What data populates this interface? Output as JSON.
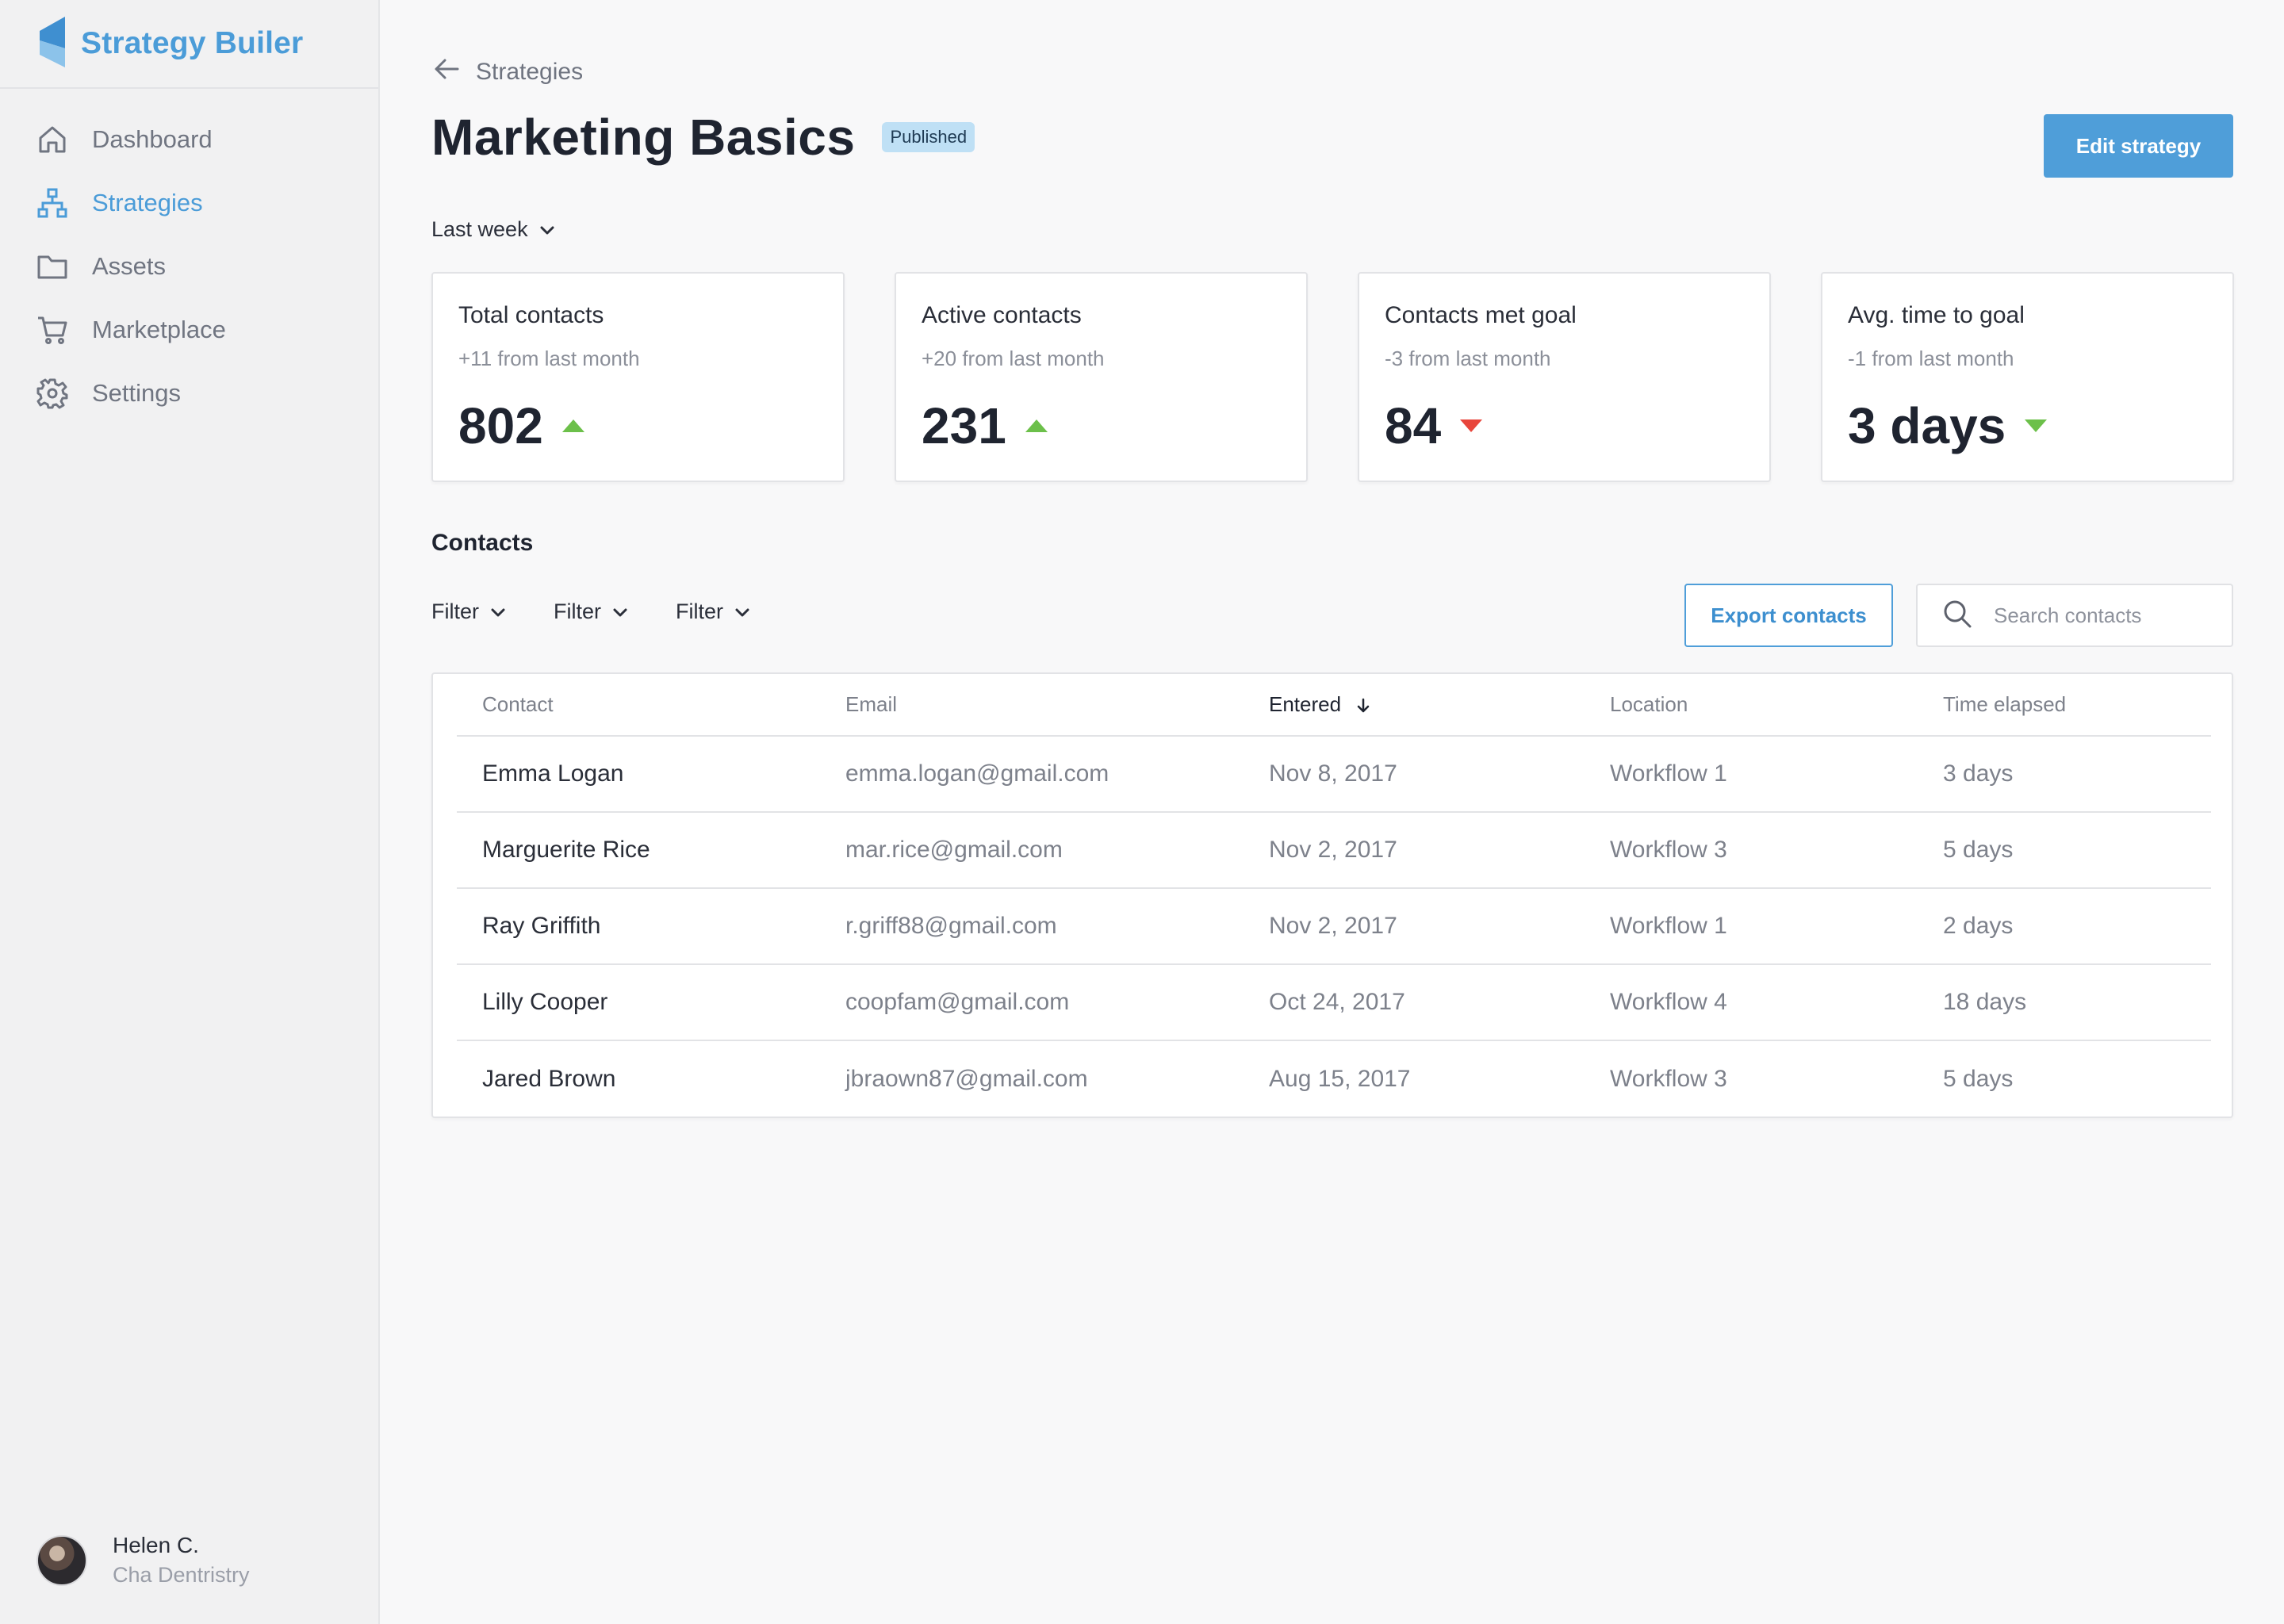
{
  "app": {
    "name": "Strategy Builer"
  },
  "sidebar": {
    "items": [
      {
        "label": "Dashboard",
        "icon": "home-icon",
        "active": false
      },
      {
        "label": "Strategies",
        "icon": "hierarchy-icon",
        "active": true
      },
      {
        "label": "Assets",
        "icon": "folder-icon",
        "active": false
      },
      {
        "label": "Marketplace",
        "icon": "cart-icon",
        "active": false
      },
      {
        "label": "Settings",
        "icon": "gear-icon",
        "active": false
      }
    ],
    "user": {
      "name": "Helen C.",
      "org": "Cha Dentristry"
    }
  },
  "header": {
    "back_label": "Strategies",
    "title": "Marketing Basics",
    "status": "Published",
    "edit_label": "Edit strategy",
    "range": "Last week"
  },
  "stats": [
    {
      "title": "Total contacts",
      "change": "+11 from last month",
      "value": "802",
      "trend": "up",
      "trend_color": "#6cc04a"
    },
    {
      "title": "Active contacts",
      "change": "+20 from last month",
      "value": "231",
      "trend": "up",
      "trend_color": "#6cc04a"
    },
    {
      "title": "Contacts met goal",
      "change": "-3 from last month",
      "value": "84",
      "trend": "down",
      "trend_color": "#e8463c"
    },
    {
      "title": "Avg. time to goal",
      "change": "-1 from last month",
      "value": "3 days",
      "trend": "down",
      "trend_color": "#6cc04a"
    }
  ],
  "contacts": {
    "title": "Contacts",
    "filters": [
      "Filter",
      "Filter",
      "Filter"
    ],
    "export_label": "Export contacts",
    "search_placeholder": "Search contacts",
    "columns": [
      "Contact",
      "Email",
      "Entered",
      "Location",
      "Time elapsed"
    ],
    "sorted_column": "Entered",
    "rows": [
      {
        "name": "Emma Logan",
        "email": "emma.logan@gmail.com",
        "entered": "Nov 8, 2017",
        "location": "Workflow 1",
        "elapsed": "3 days"
      },
      {
        "name": "Marguerite Rice",
        "email": "mar.rice@gmail.com",
        "entered": "Nov 2, 2017",
        "location": "Workflow 3",
        "elapsed": "5 days"
      },
      {
        "name": "Ray Griffith",
        "email": "r.griff88@gmail.com",
        "entered": "Nov 2, 2017",
        "location": "Workflow 1",
        "elapsed": "2 days"
      },
      {
        "name": "Lilly Cooper",
        "email": "coopfam@gmail.com",
        "entered": "Oct 24, 2017",
        "location": "Workflow 4",
        "elapsed": "18 days"
      },
      {
        "name": "Jared Brown",
        "email": "jbraown87@gmail.com",
        "entered": "Aug 15, 2017",
        "location": "Workflow 3",
        "elapsed": "5 days"
      }
    ]
  },
  "colors": {
    "accent": "#4f9ed9",
    "brand": "#4b9cd8",
    "up": "#6cc04a",
    "down": "#e8463c"
  }
}
